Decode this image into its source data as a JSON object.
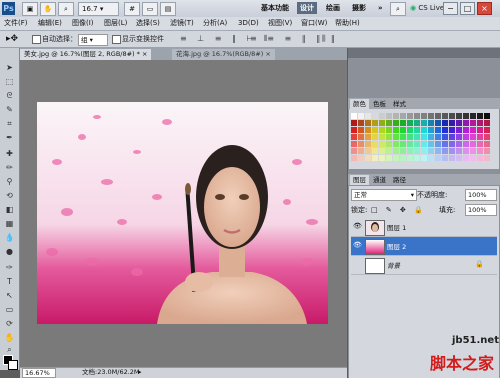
{
  "title_bar": {
    "app_icon": "Ps",
    "tool_icons": [
      "frame-icon",
      "hand-icon",
      "zoom-icon"
    ],
    "zoom": "16.7",
    "arrange_icons": [
      "grid-icon",
      "screen-mode-icon",
      "extras-icon"
    ],
    "workspace_buttons": [
      "基本功能",
      "设计",
      "绘画",
      "摄影"
    ],
    "more": "»",
    "search_icon": "search-icon",
    "cs_live": "CS Live",
    "window_buttons": [
      "−",
      "□",
      "×"
    ]
  },
  "menu": [
    "文件(F)",
    "编辑(E)",
    "图像(I)",
    "图层(L)",
    "选择(S)",
    "滤镜(T)",
    "分析(A)",
    "3D(D)",
    "视图(V)",
    "窗口(W)",
    "帮助(H)"
  ],
  "options_bar": {
    "auto_select_label": "自动选择：",
    "auto_select_value": "组",
    "show_transform_label": "显示变换控件"
  },
  "tabs": [
    {
      "label": "美女.jpg @ 16.7%(图层 2, RGB/8#) *",
      "close": "×"
    },
    {
      "label": "花海.jpg @ 16.7%(RGB/8#)",
      "close": "×"
    }
  ],
  "status": {
    "zoom": "16.67%",
    "doc": "文档:23.0M/62.2M"
  },
  "panels": {
    "top_tabs": [
      "颜色",
      "色板",
      "样式"
    ],
    "layer_tabs": [
      "图层",
      "通道",
      "路径"
    ],
    "blend_mode": "正常",
    "opacity_label": "不透明度:",
    "opacity": "100%",
    "lock_label": "锁定:",
    "fill_label": "填充:",
    "fill": "100%",
    "layers": [
      {
        "name": "图层 1",
        "visible": true,
        "selected": false
      },
      {
        "name": "图层 2",
        "visible": true,
        "selected": true
      },
      {
        "name": "背景",
        "visible": false,
        "selected": false
      }
    ],
    "background_lock": "lock-icon"
  },
  "watermark": {
    "url": "jb51.net",
    "name": "脚本之家"
  },
  "colors": {
    "accent": "#3a74c9",
    "pink": "#e0207a"
  }
}
